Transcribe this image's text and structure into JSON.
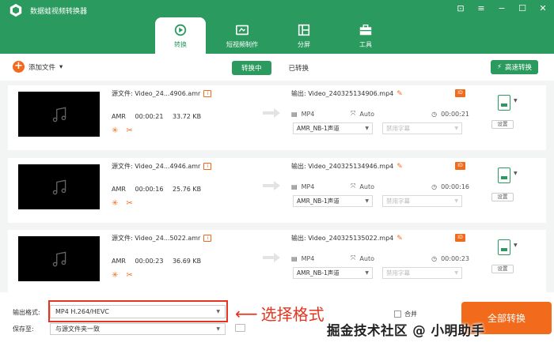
{
  "app": {
    "title": "数据蛙视频转换器",
    "accent_color": "#2b9a5e",
    "orange_color": "#f26b1d"
  },
  "window_controls": [
    "gift-icon",
    "menu-icon",
    "minimize-icon",
    "maximize-icon",
    "close-icon"
  ],
  "tabs": [
    {
      "label": "转换",
      "icon": "convert-icon",
      "active": true
    },
    {
      "label": "短视频制作",
      "icon": "short-video-icon",
      "active": false
    },
    {
      "label": "分屏",
      "icon": "split-screen-icon",
      "active": false
    },
    {
      "label": "工具",
      "icon": "toolbox-icon",
      "active": false
    }
  ],
  "toolbar": {
    "add_file": "添加文件",
    "converting": "转换中",
    "converted": "已转换",
    "fast_convert": "高速转换"
  },
  "files": [
    {
      "source_label": "源文件: Video_24...4906.amr",
      "format": "AMR",
      "duration": "00:00:21",
      "size": "33.72 KB",
      "output_label": "输出: Video_240325134906.mp4",
      "out_format": "MP4",
      "out_res": "Auto",
      "out_duration": "00:00:21",
      "audio": "AMR_NB-1声道",
      "subtitle": "禁用字幕",
      "settings": "设置"
    },
    {
      "source_label": "源文件: Video_24...4946.amr",
      "format": "AMR",
      "duration": "00:00:16",
      "size": "25.76 KB",
      "output_label": "输出: Video_240325134946.mp4",
      "out_format": "MP4",
      "out_res": "Auto",
      "out_duration": "00:00:16",
      "audio": "AMR_NB-1声道",
      "subtitle": "禁用字幕",
      "settings": "设置"
    },
    {
      "source_label": "源文件: Video_24...5022.amr",
      "format": "AMR",
      "duration": "00:00:23",
      "size": "36.69 KB",
      "output_label": "输出: Video_240325135022.mp4",
      "out_format": "MP4",
      "out_res": "Auto",
      "out_duration": "00:00:23",
      "audio": "AMR_NB-1声道",
      "subtitle": "禁用字幕",
      "settings": "设置"
    }
  ],
  "bottom": {
    "output_format_label": "输出格式:",
    "output_format_value": "MP4 H.264/HEVC",
    "save_to_label": "保存至:",
    "save_to_value": "与源文件夹一致",
    "annotation": "选择格式",
    "merge_label": "合并",
    "convert_all": "全部转换",
    "watermark": "掘金技术社区 @ 小明助手"
  }
}
